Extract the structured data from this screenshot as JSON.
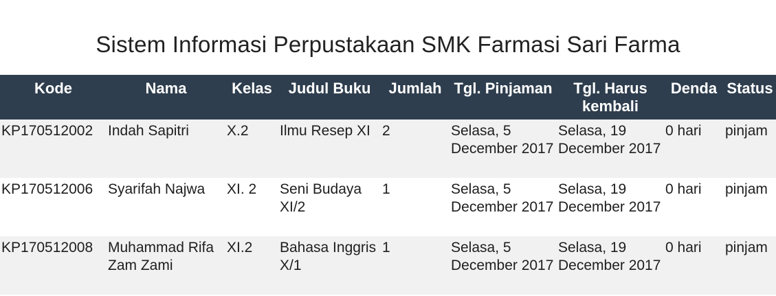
{
  "page": {
    "title": "Sistem Informasi Perpustakaan SMK Farmasi Sari Farma"
  },
  "table": {
    "headers": {
      "kode": "Kode",
      "nama": "Nama",
      "kelas": "Kelas",
      "judul_buku": "Judul Buku",
      "jumlah": "Jumlah",
      "tgl_pinjaman": "Tgl. Pinjaman",
      "tgl_harus_kembali": "Tgl. Harus kembali",
      "denda": "Denda",
      "status": "Status"
    },
    "rows": [
      {
        "kode": "KP170512002",
        "nama": "Indah Sapitri",
        "kelas": "X.2",
        "judul_buku": "Ilmu Resep XI",
        "jumlah": "2",
        "tgl_pinjaman": "Selasa, 5 December 2017",
        "tgl_harus_kembali": "Selasa, 19 December 2017",
        "denda": "0 hari",
        "status": "pinjam"
      },
      {
        "kode": "KP170512006",
        "nama": "Syarifah Najwa",
        "kelas": "XI. 2",
        "judul_buku": "Seni Budaya XI/2",
        "jumlah": "1",
        "tgl_pinjaman": "Selasa, 5 December 2017",
        "tgl_harus_kembali": "Selasa, 19 December 2017",
        "denda": "0 hari",
        "status": "pinjam"
      },
      {
        "kode": "KP170512008",
        "nama": "Muhammad Rifa Zam Zami",
        "kelas": "XI.2",
        "judul_buku": "Bahasa Inggris X/1",
        "jumlah": "1",
        "tgl_pinjaman": "Selasa, 5 December 2017",
        "tgl_harus_kembali": "Selasa, 19 December 2017",
        "denda": "0 hari",
        "status": "pinjam"
      }
    ]
  },
  "colors": {
    "header_background": "#2f3e4e",
    "header_text": "#ffffff",
    "stripe_row": "#f1f1f1"
  }
}
